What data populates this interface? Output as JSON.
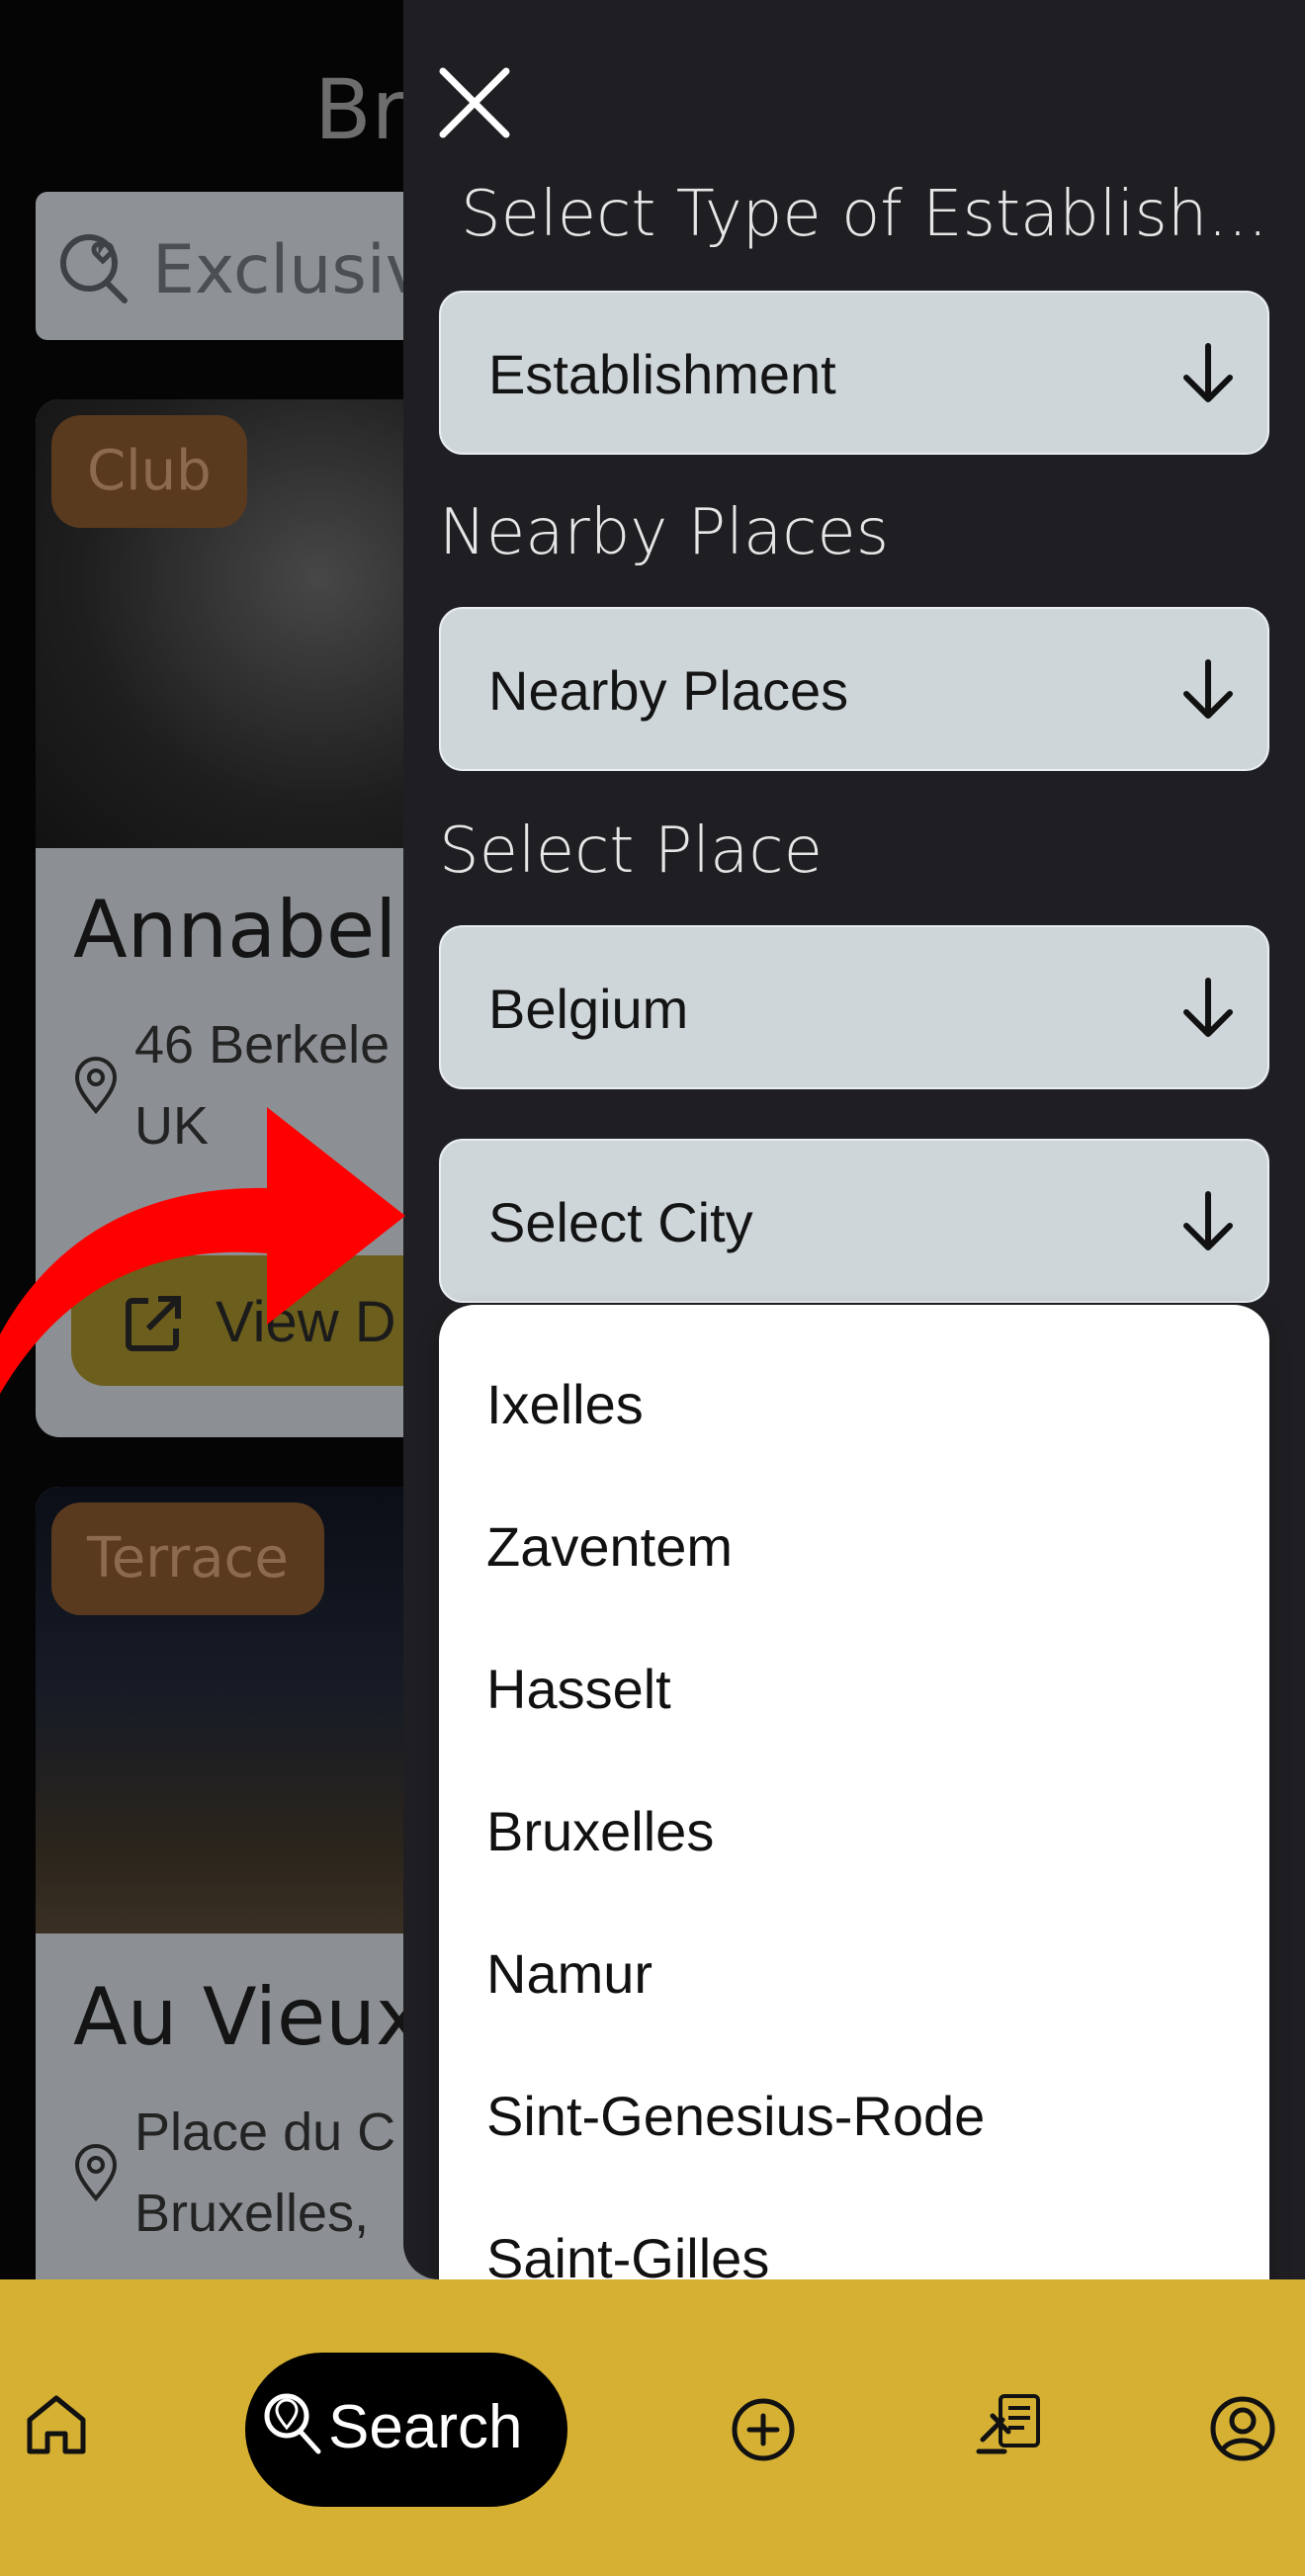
{
  "background": {
    "title": "Br",
    "search_label": "Exclusive",
    "cards": [
      {
        "tag": "Club",
        "name": "Annabel",
        "address_line1": "46 Berkele",
        "address_line2": "UK",
        "button_label": "View D"
      },
      {
        "tag": "Terrace",
        "name": "Au Vieux",
        "address_line1": "Place du C",
        "address_line2": "Bruxelles,"
      }
    ]
  },
  "drawer": {
    "type_label": "Select Type of Establish...",
    "type_value": "Establishment",
    "nearby_label": "Nearby Places",
    "nearby_value": "Nearby Places",
    "place_label": "Select Place",
    "place_value": "Belgium",
    "city_value": "Select City",
    "city_options": [
      "Ixelles",
      "Zaventem",
      "Hasselt",
      "Bruxelles",
      "Namur",
      "Sint-Genesius-Rode",
      "Saint-Gilles"
    ]
  },
  "bottom_nav": {
    "search_label": "Search",
    "icons": [
      "home-icon",
      "search-pin-icon",
      "add-circle-icon",
      "document-gavel-icon",
      "profile-icon"
    ]
  },
  "colors": {
    "drawer_bg": "#1f1e22",
    "select_bg": "#cfd6da",
    "nav_bg": "#d5b033",
    "arrow_red": "#ff0000"
  }
}
